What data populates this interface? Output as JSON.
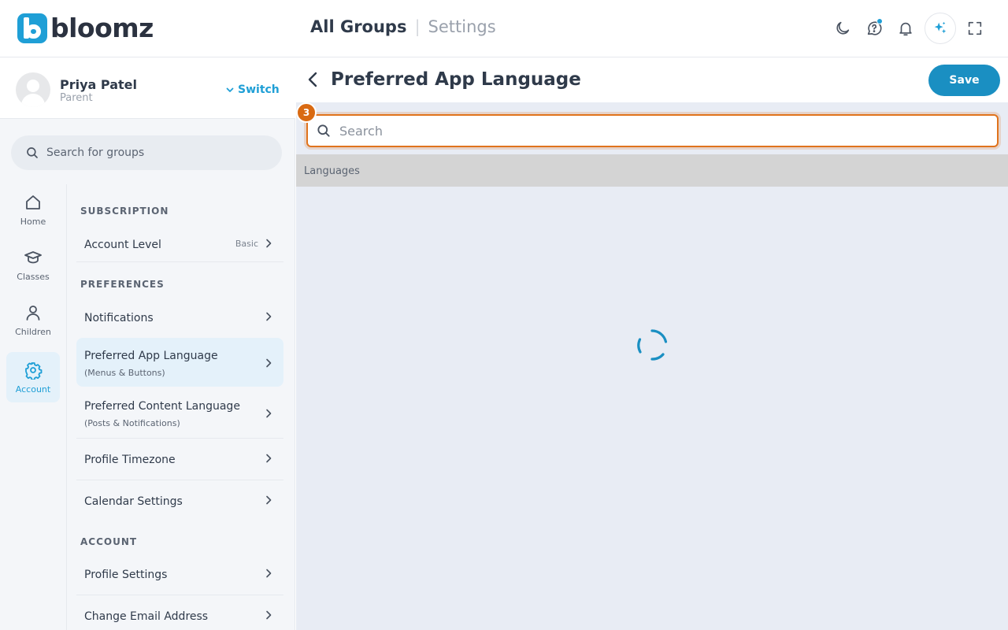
{
  "app": {
    "logo_text": "bloomz",
    "brand_color": "#1f9fd6",
    "accent_color": "#e0731c"
  },
  "header": {
    "crumb_main": "All Groups",
    "crumb_sep": "|",
    "crumb_sub": "Settings",
    "icons": [
      "moon-icon",
      "help-chat-icon",
      "bell-icon",
      "ai-sparkle-icon",
      "fullscreen-icon"
    ]
  },
  "profile": {
    "name": "Priya Patel",
    "role": "Parent",
    "switch_label": "Switch"
  },
  "group_search": {
    "placeholder": "Search for groups"
  },
  "rail": {
    "items": [
      {
        "label": "Home",
        "icon": "home-icon"
      },
      {
        "label": "Classes",
        "icon": "graduation-cap-icon"
      },
      {
        "label": "Children",
        "icon": "person-icon"
      },
      {
        "label": "Account",
        "icon": "gear-icon",
        "active": true
      }
    ]
  },
  "menu": {
    "sections": {
      "subscription": "SUBSCRIPTION",
      "preferences": "PREFERENCES",
      "account": "ACCOUNT"
    },
    "items": {
      "account_level": {
        "label": "Account Level",
        "value": "Basic"
      },
      "notifications": {
        "label": "Notifications"
      },
      "app_language": {
        "label": "Preferred App Language",
        "sub": "(Menus & Buttons)"
      },
      "content_language": {
        "label": "Preferred Content Language",
        "sub": "(Posts & Notifications)"
      },
      "timezone": {
        "label": "Profile Timezone"
      },
      "calendar": {
        "label": "Calendar Settings"
      },
      "profile_settings": {
        "label": "Profile Settings"
      },
      "change_email": {
        "label": "Change Email Address"
      }
    }
  },
  "main": {
    "title": "Preferred App Language",
    "save_label": "Save",
    "search_placeholder": "Search",
    "step_badge": "3",
    "list_header": "Languages"
  }
}
